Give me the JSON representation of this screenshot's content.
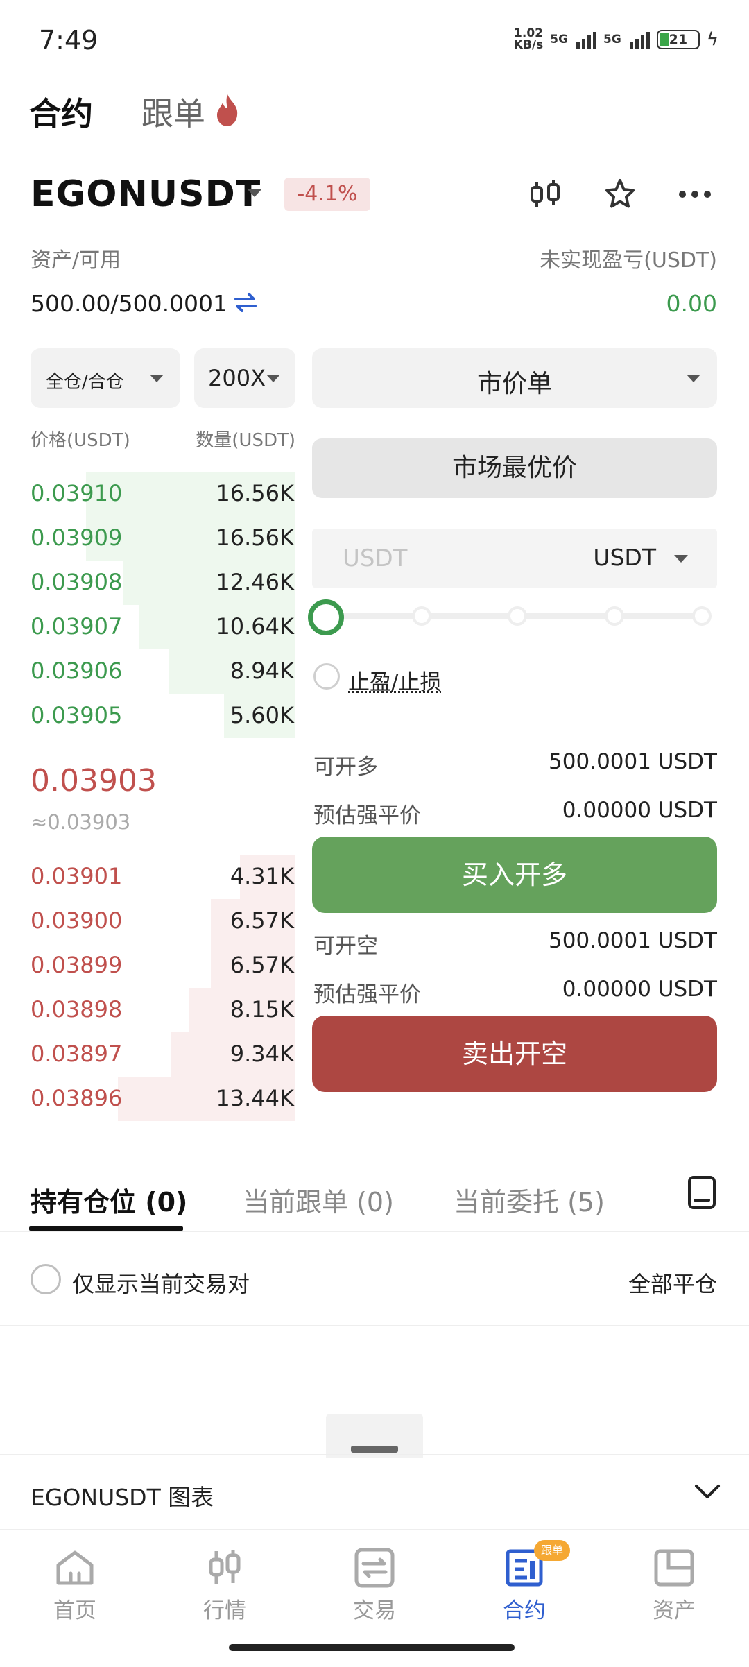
{
  "status_bar": {
    "time": "7:49",
    "net_speed_value": "1.02",
    "net_speed_unit": "KB/s",
    "sim1": "5G",
    "sim2": "5G",
    "battery": "21"
  },
  "top_tabs": {
    "contract": "合约",
    "copy_trade": "跟单"
  },
  "symbol": {
    "name": "EGONUSDT",
    "change": "-4.1%"
  },
  "account": {
    "asset_label": "资产/可用",
    "asset_value": "500.00/500.0001",
    "pnl_label": "未实现盈亏(USDT)",
    "pnl_value": "0.00"
  },
  "selectors": {
    "margin_mode": "全仓/合仓",
    "leverage": "200X",
    "order_type": "市价单",
    "best_price": "市场最优价",
    "amount_placeholder": "USDT",
    "amount_unit": "USDT",
    "slider_level": 0
  },
  "order_book": {
    "price_header": "价格(USDT)",
    "qty_header": "数量(USDT)",
    "asks": [
      {
        "price": "0.03910",
        "qty": "16.56K",
        "depth": 0.79
      },
      {
        "price": "0.03909",
        "qty": "16.56K",
        "depth": 0.79
      },
      {
        "price": "0.03908",
        "qty": "12.46K",
        "depth": 0.65
      },
      {
        "price": "0.03907",
        "qty": "10.64K",
        "depth": 0.59
      },
      {
        "price": "0.03906",
        "qty": "8.94K",
        "depth": 0.48
      },
      {
        "price": "0.03905",
        "qty": "5.60K",
        "depth": 0.27
      }
    ],
    "last_price": "0.03903",
    "last_price_approx": "≈0.03903",
    "bids": [
      {
        "price": "0.03901",
        "qty": "4.31K",
        "depth": 0.21
      },
      {
        "price": "0.03900",
        "qty": "6.57K",
        "depth": 0.32
      },
      {
        "price": "0.03899",
        "qty": "6.57K",
        "depth": 0.32
      },
      {
        "price": "0.03898",
        "qty": "8.15K",
        "depth": 0.4
      },
      {
        "price": "0.03897",
        "qty": "9.34K",
        "depth": 0.47
      },
      {
        "price": "0.03896",
        "qty": "13.44K",
        "depth": 0.67
      }
    ]
  },
  "trade": {
    "tp_sl": "止盈/止损",
    "can_long_label": "可开多",
    "can_long_value": "500.0001 USDT",
    "liq_label_long": "预估强平价",
    "liq_value_long": "0.00000 USDT",
    "buy_button": "买入开多",
    "can_short_label": "可开空",
    "can_short_value": "500.0001 USDT",
    "liq_label_short": "预估强平价",
    "liq_value_short": "0.00000 USDT",
    "sell_button": "卖出开空"
  },
  "positions": {
    "tabs": [
      "持有仓位 (0)",
      "当前跟单 (0)",
      "当前委托 (5)"
    ],
    "only_current": "仅显示当前交易对",
    "close_all": "全部平仓"
  },
  "chart_panel": {
    "label": "EGONUSDT 图表"
  },
  "nav": {
    "items": [
      "首页",
      "行情",
      "交易",
      "合约",
      "资产"
    ],
    "badge": "跟单"
  },
  "colors": {
    "green": "#3c9a4e",
    "red": "#c0504d",
    "accent": "#2f5fcf"
  }
}
